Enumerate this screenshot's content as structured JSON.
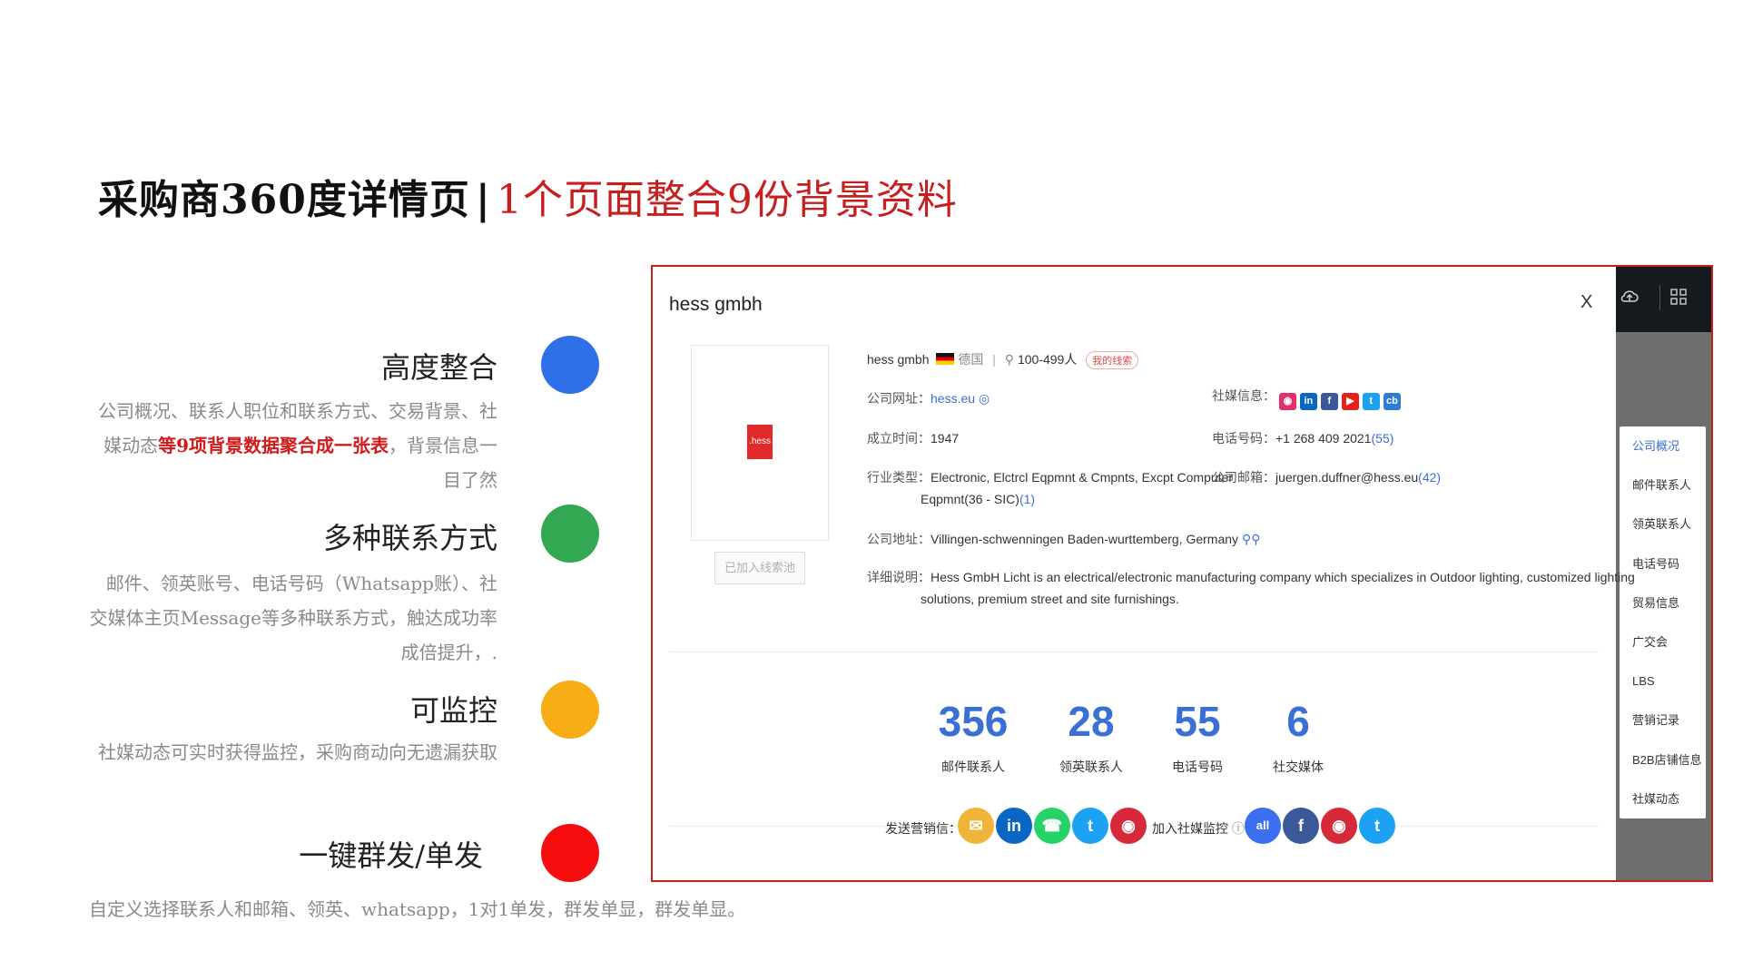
{
  "slide": {
    "title": "采购商360度详情页",
    "separator": "|",
    "subtitle": "1个页面整合9份背景资料"
  },
  "features": [
    {
      "title": "高度整合",
      "desc_pre": "公司概况、联系人职位和联系方式、交易背景、社媒动态",
      "desc_highlight": "等9项背景数据聚合成一张表",
      "desc_post": "，背景信息一目了然",
      "dot_color": "#2f6fe8"
    },
    {
      "title": "多种联系方式",
      "desc": "邮件、领英账号、电话号码（Whatsapp账）、社交媒体主页Message等多种联系方式，触达成功率成倍提升，.",
      "dot_color": "#33a852"
    },
    {
      "title": "可监控",
      "desc": "社媒动态可实时获得监控，采购商动向无遗漏获取",
      "dot_color": "#f6ad16"
    },
    {
      "title": "一键群发/单发",
      "dot_color": "#f70d0d"
    }
  ],
  "bottom_note": "自定义选择联系人和邮箱、领英、whatsapp，1对1单发，群发单显，群发单显。",
  "panel": {
    "title": "hess gmbh",
    "close": "X",
    "logo_text": ".hess",
    "pool_button": "已加入线索池",
    "company": {
      "name": "hess gmbh",
      "country": "德国",
      "size": "100-499人",
      "tag": "我的线索",
      "website_label": "公司网址：",
      "website": "hess.eu",
      "founded_label": "成立时间：",
      "founded": "1947",
      "industry_label": "行业类型：",
      "industry_line1": "Electronic, Elctrcl Eqpmnt & Cmpnts, Excpt Computer",
      "industry_line2": "Eqpmnt(36 - SIC)",
      "industry_count": "(1)",
      "address_label": "公司地址：",
      "address": "Villingen-schwenningen Baden-wurttemberg, Germany",
      "detail_label": "详细说明：",
      "detail_line1": "Hess GmbH Licht is an electrical/electronic manufacturing company which specializes in Outdoor lighting, customized lighting",
      "detail_line2": "solutions, premium street and site furnishings.",
      "social_label": "社媒信息：",
      "phone_label": "电话号码：",
      "phone": "+1 268 409 2021",
      "phone_count": "(55)",
      "email_label": "公司邮箱：",
      "email": "juergen.duffner@hess.eu",
      "email_count": "(42)"
    },
    "stats": [
      {
        "value": "356",
        "label": "邮件联系人"
      },
      {
        "value": "28",
        "label": "领英联系人"
      },
      {
        "value": "55",
        "label": "电话号码"
      },
      {
        "value": "6",
        "label": "社交媒体"
      }
    ],
    "actions": {
      "send_label": "发送营销信：",
      "monitor_label": "加入社媒监控",
      "all_label": "all"
    },
    "nav": [
      "公司概况",
      "邮件联系人",
      "领英联系人",
      "电话号码",
      "贸易信息",
      "广交会",
      "LBS",
      "营销记录",
      "B2B店铺信息",
      "社媒动态"
    ],
    "colors": {
      "accent": "#3b6ed8",
      "brand_red": "#c81e1e"
    }
  }
}
